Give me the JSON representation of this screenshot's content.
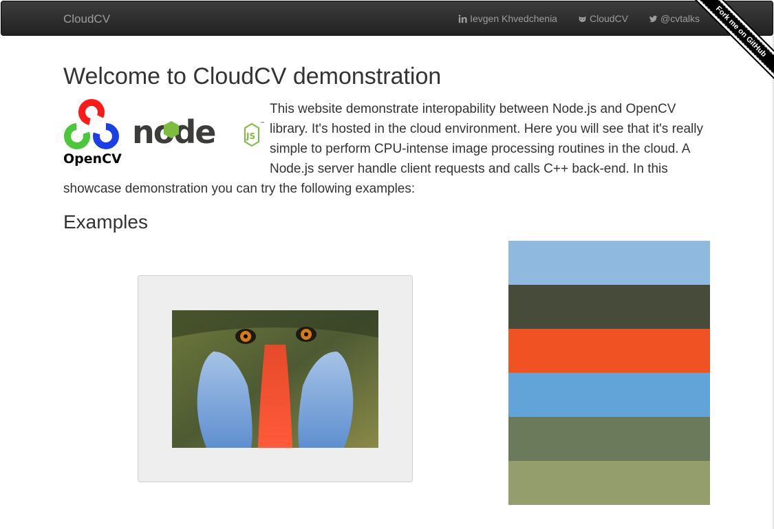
{
  "navbar": {
    "brand": "CloudCV",
    "links": [
      {
        "label": "Ievgen Khvedchenia",
        "icon": "linkedin-icon"
      },
      {
        "label": "CloudCV",
        "icon": "github-icon"
      },
      {
        "label": "@cvtalks",
        "icon": "twitter-icon"
      }
    ],
    "ribbon": "Fork me on GitHub"
  },
  "main": {
    "title": "Welcome to CloudCV demonstration",
    "intro": "This website demonstrate interopability between Node.js and OpenCV library. It's hosted in the cloud environment. Here you will see that it's really simple to perform CPU-intense image processing routines in the cloud. A Node.js server handle client requests and calls C++ back-end. In this showcase demonstration you can try the following examples:",
    "examples_heading": "Examples"
  },
  "logos": {
    "opencv_text": "OpenCV",
    "node_text": "node",
    "js_text": "JS",
    "tm": "™"
  },
  "palette": {
    "colors": [
      "#8fb9de",
      "#474c3a",
      "#f05223",
      "#62a3d8",
      "#6a7a5a",
      "#939e6c"
    ]
  }
}
